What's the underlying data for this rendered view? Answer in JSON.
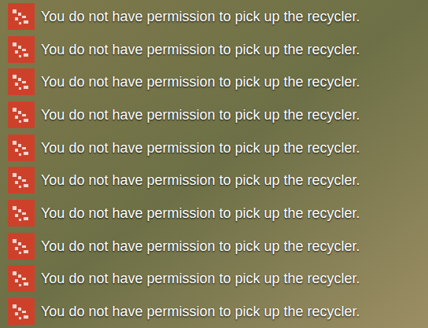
{
  "notifications": [
    {
      "text": "You do not have permission to pick up the recycler."
    },
    {
      "text": "You do not have permission to pick up the recycler."
    },
    {
      "text": "You do not have permission to pick up the recycler."
    },
    {
      "text": "You do not have permission to pick up the recycler."
    },
    {
      "text": "You do not have permission to pick up the recycler."
    },
    {
      "text": "You do not have permission to pick up the recycler."
    },
    {
      "text": "You do not have permission to pick up the recycler."
    },
    {
      "text": "You do not have permission to pick up the recycler."
    },
    {
      "text": "You do not have permission to pick up the recycler."
    },
    {
      "text": "You do not have permission to pick up the recycler."
    }
  ]
}
